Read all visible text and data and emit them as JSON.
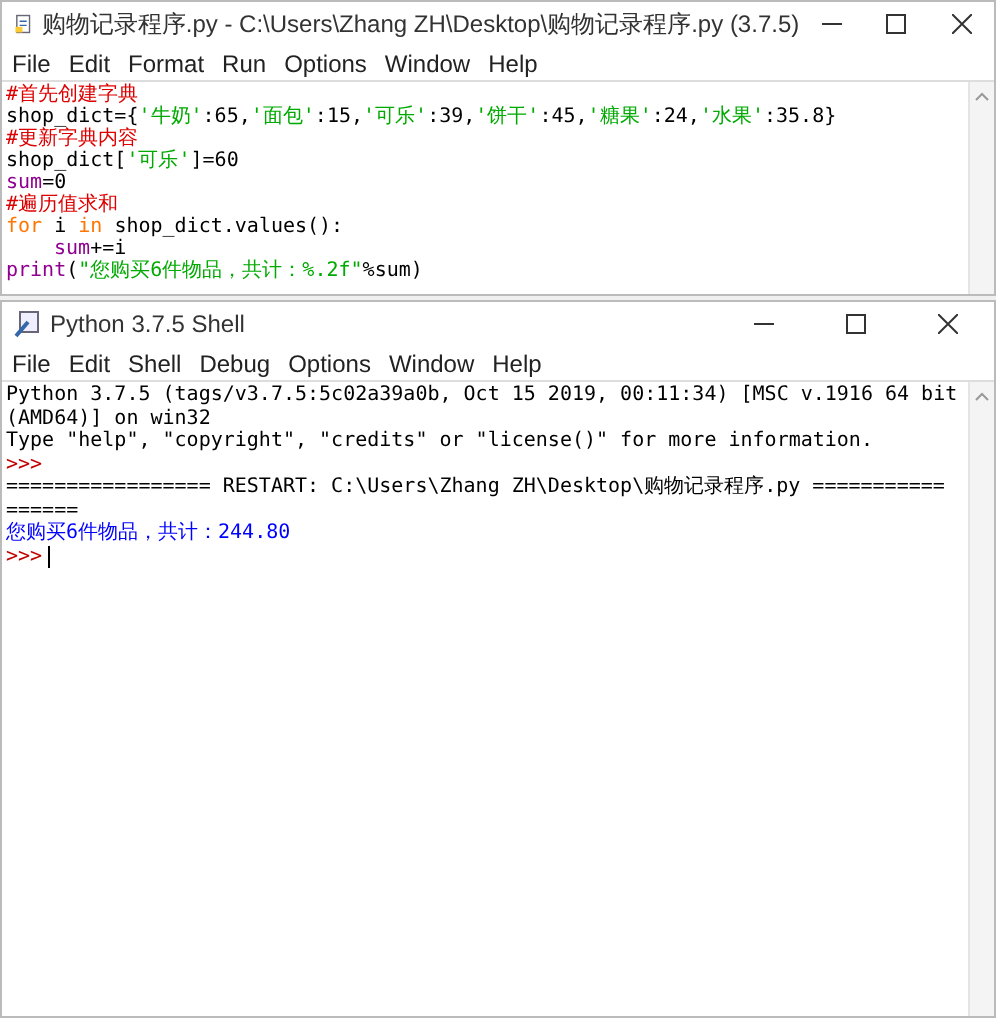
{
  "editor": {
    "title": "购物记录程序.py - C:\\Users\\Zhang ZH\\Desktop\\购物记录程序.py (3.7.5)",
    "menu": [
      "File",
      "Edit",
      "Format",
      "Run",
      "Options",
      "Window",
      "Help"
    ],
    "lines": [
      {
        "indent": false,
        "tokens": [
          {
            "kind": "comment",
            "text": "#首先创建字典"
          }
        ]
      },
      {
        "indent": false,
        "tokens": [
          {
            "kind": "plain",
            "text": "shop_dict={"
          },
          {
            "kind": "string",
            "text": "'牛奶'"
          },
          {
            "kind": "plain",
            "text": ":65,"
          },
          {
            "kind": "string",
            "text": "'面包'"
          },
          {
            "kind": "plain",
            "text": ":15,"
          },
          {
            "kind": "string",
            "text": "'可乐'"
          },
          {
            "kind": "plain",
            "text": ":39,"
          },
          {
            "kind": "string",
            "text": "'饼干'"
          },
          {
            "kind": "plain",
            "text": ":45,"
          },
          {
            "kind": "string",
            "text": "'糖果'"
          },
          {
            "kind": "plain",
            "text": ":24,"
          },
          {
            "kind": "string",
            "text": "'水果'"
          },
          {
            "kind": "plain",
            "text": ":35.8}"
          }
        ]
      },
      {
        "indent": false,
        "tokens": [
          {
            "kind": "comment",
            "text": "#更新字典内容"
          }
        ]
      },
      {
        "indent": false,
        "tokens": [
          {
            "kind": "plain",
            "text": "shop_dict["
          },
          {
            "kind": "string",
            "text": "'可乐'"
          },
          {
            "kind": "plain",
            "text": "]=60"
          }
        ]
      },
      {
        "indent": false,
        "tokens": [
          {
            "kind": "builtin",
            "text": "sum"
          },
          {
            "kind": "plain",
            "text": "=0"
          }
        ]
      },
      {
        "indent": false,
        "tokens": [
          {
            "kind": "comment",
            "text": "#遍历值求和"
          }
        ]
      },
      {
        "indent": false,
        "tokens": [
          {
            "kind": "keyword",
            "text": "for"
          },
          {
            "kind": "plain",
            "text": " i "
          },
          {
            "kind": "keyword",
            "text": "in"
          },
          {
            "kind": "plain",
            "text": " shop_dict.values():"
          }
        ]
      },
      {
        "indent": true,
        "tokens": [
          {
            "kind": "builtin",
            "text": "sum"
          },
          {
            "kind": "plain",
            "text": "+=i"
          }
        ]
      },
      {
        "indent": false,
        "tokens": [
          {
            "kind": "builtin",
            "text": "print"
          },
          {
            "kind": "plain",
            "text": "("
          },
          {
            "kind": "string",
            "text": "\"您购买6件物品，共计：%.2f\""
          },
          {
            "kind": "plain",
            "text": "%sum)"
          }
        ]
      }
    ]
  },
  "shell": {
    "title": "Python 3.7.5 Shell",
    "menu": [
      "File",
      "Edit",
      "Shell",
      "Debug",
      "Options",
      "Window",
      "Help"
    ],
    "lines": [
      {
        "kind": "output",
        "text": "Python 3.7.5 (tags/v3.7.5:5c02a39a0b, Oct 15 2019, 00:11:34) [MSC v.1916 64 bit"
      },
      {
        "kind": "output",
        "text": "(AMD64)] on win32"
      },
      {
        "kind": "output",
        "text": "Type \"help\", \"copyright\", \"credits\" or \"license()\" for more information."
      },
      {
        "kind": "prompt",
        "text": ">>>"
      },
      {
        "kind": "output",
        "text": "================= RESTART: C:\\Users\\Zhang ZH\\Desktop\\购物记录程序.py ==========="
      },
      {
        "kind": "output",
        "text": "======"
      },
      {
        "kind": "stdout",
        "text": "您购买6件物品，共计：244.80"
      },
      {
        "kind": "cursor",
        "text": ">>>"
      }
    ]
  }
}
